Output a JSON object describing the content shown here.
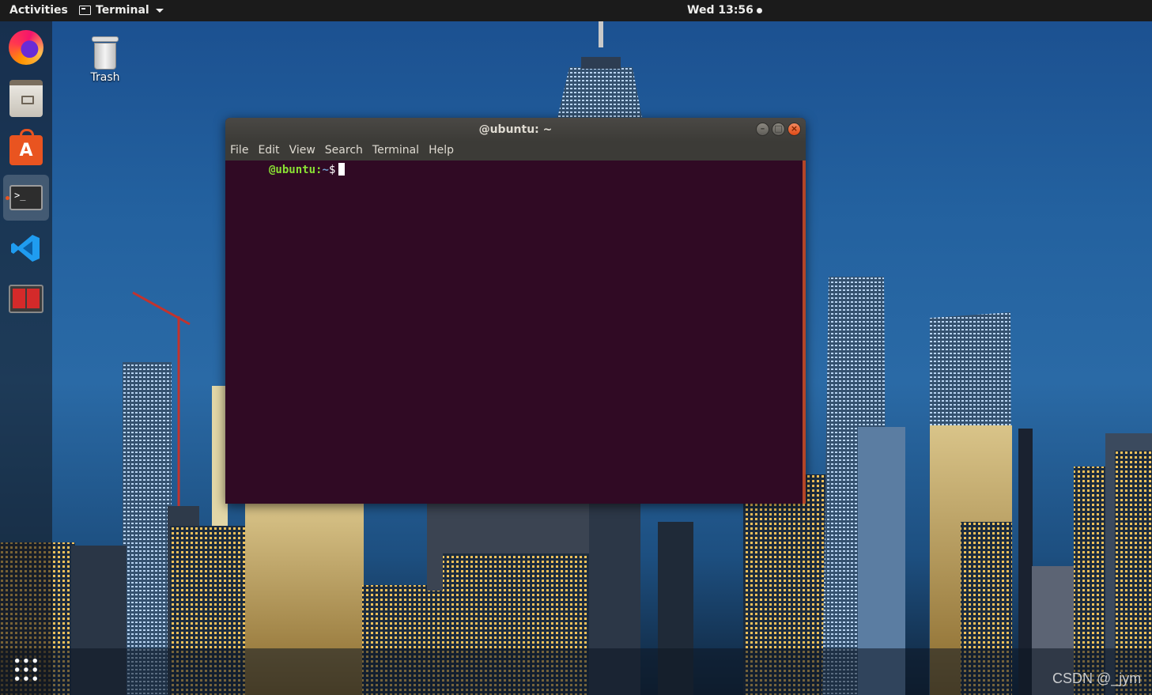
{
  "topbar": {
    "activities": "Activities",
    "app_name": "Terminal",
    "clock": "Wed 13:56"
  },
  "dock": {
    "apps": [
      "firefox-icon",
      "files-icon",
      "software-icon",
      "terminal-icon",
      "vscode-icon",
      "split-terminal-icon"
    ],
    "show_apps": "apps-grid-icon",
    "active_app": "terminal"
  },
  "desktop": {
    "trash_label": "Trash"
  },
  "terminal": {
    "title": "@ubuntu: ~",
    "menu": [
      "File",
      "Edit",
      "View",
      "Search",
      "Terminal",
      "Help"
    ],
    "prompt_host": "@ubuntu",
    "prompt_path": "~",
    "prompt_symbol": "$",
    "colors": {
      "background": "#300a24",
      "host": "#8ae234",
      "path": "#729fcf"
    }
  },
  "watermark": "CSDN @_jym"
}
